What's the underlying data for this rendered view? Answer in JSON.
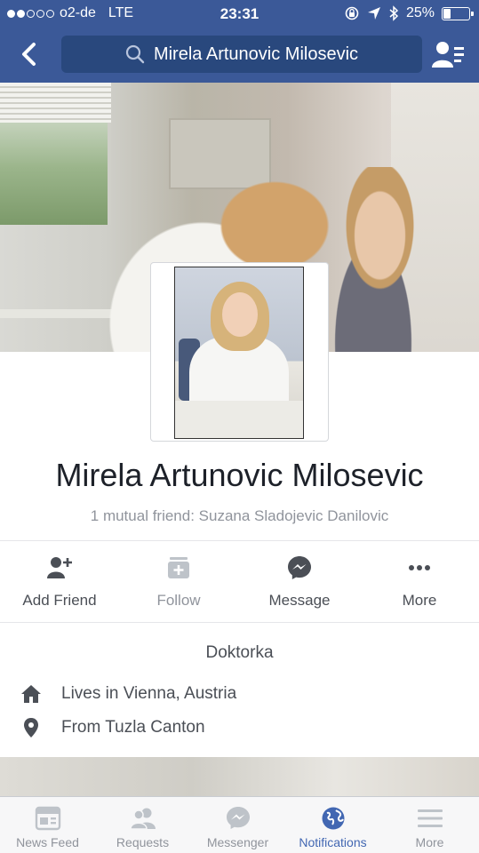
{
  "status_bar": {
    "carrier": "o2-de",
    "network": "LTE",
    "time": "23:31",
    "battery": "25%",
    "battery_level": 0.25,
    "signal_bars_filled": 2,
    "signal_bars_total": 5
  },
  "header": {
    "search_text": "Mirela Artunovic Milosevic",
    "back_icon": "chevron-left-icon",
    "friends_icon": "friend-requests-icon"
  },
  "profile": {
    "name": "Mirela Artunovic Milosevic",
    "mutual_friends": "1 mutual friend: Suzana Sladojevic Danilovic"
  },
  "actions": [
    {
      "label": "Add Friend",
      "icon": "add-friend-icon"
    },
    {
      "label": "Follow",
      "icon": "follow-icon"
    },
    {
      "label": "Message",
      "icon": "messenger-icon"
    },
    {
      "label": "More",
      "icon": "more-dots-icon"
    }
  ],
  "intro": {
    "bio": "Doktorka",
    "lives_in": "Lives in Vienna, Austria",
    "from": "From Tuzla Canton"
  },
  "tabs": [
    {
      "label": "News Feed",
      "icon": "news-feed-icon"
    },
    {
      "label": "Requests",
      "icon": "friend-requests-icon"
    },
    {
      "label": "Messenger",
      "icon": "messenger-icon"
    },
    {
      "label": "Notifications",
      "icon": "globe-icon",
      "active": true
    },
    {
      "label": "More",
      "icon": "menu-icon"
    }
  ],
  "colors": {
    "brand": "#3b5998",
    "search_bg": "#29487d",
    "active_tab": "#4267b2",
    "muted_text": "#90949c",
    "action_icon": "#4b4f56"
  }
}
